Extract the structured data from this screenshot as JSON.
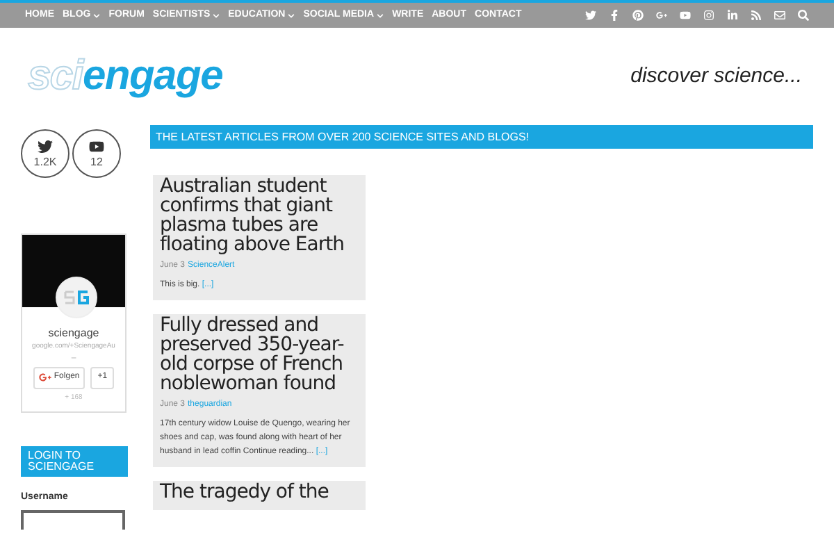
{
  "nav": [
    {
      "label": "HOME",
      "has_menu": false
    },
    {
      "label": "BLOG",
      "has_menu": true
    },
    {
      "label": "FORUM",
      "has_menu": false
    },
    {
      "label": "SCIENTISTS",
      "has_menu": true
    },
    {
      "label": "EDUCATION",
      "has_menu": true
    },
    {
      "label": "SOCIAL MEDIA",
      "has_menu": true
    },
    {
      "label": "WRITE",
      "has_menu": false
    },
    {
      "label": "ABOUT",
      "has_menu": false
    },
    {
      "label": "CONTACT",
      "has_menu": false
    }
  ],
  "logo": {
    "light": "sci",
    "bold": "engage"
  },
  "tagline": "discover science...",
  "social_counts": [
    {
      "kind": "twitter",
      "count": "1.2K"
    },
    {
      "kind": "youtube",
      "count": "12"
    }
  ],
  "gplus_card": {
    "name": "sciengage",
    "url": "google.com/+SciengageAu",
    "separator": "–",
    "follow": "Folgen",
    "plus_one": "+1",
    "followers": "+ 168"
  },
  "login": {
    "title": "LOGIN TO SCIENGAGE",
    "username_label": "Username"
  },
  "banner": "THE LATEST ARTICLES FROM OVER 200 SCIENCE SITES AND BLOGS!",
  "articles": [
    {
      "title": "Australian student confirms that giant plasma tubes are floating above Earth",
      "date": "June 3",
      "source": "ScienceAlert",
      "excerpt": "This is big.",
      "more": "[...]"
    },
    {
      "title": "Fully dressed and preserved 350-year-old corpse of French noblewoman found",
      "date": "June 3",
      "source": "theguardian",
      "excerpt": "17th century widow Louise de Quengo, wearing her shoes and cap, was found along with heart of her husband in lead coffin Continue reading...",
      "more": "[...]"
    },
    {
      "title": "The tragedy of the"
    }
  ]
}
